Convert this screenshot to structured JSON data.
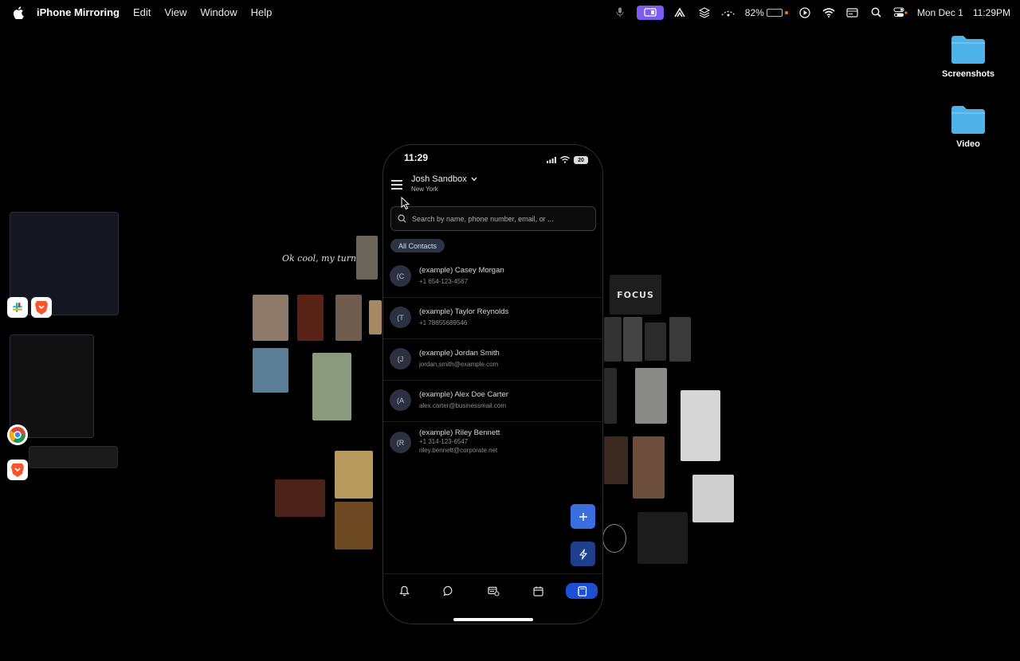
{
  "menubar": {
    "app_name": "iPhone Mirroring",
    "menus": [
      "Edit",
      "View",
      "Window",
      "Help"
    ],
    "battery_percent": "82%",
    "date": "Mon Dec 1",
    "time": "11:29PM",
    "icons": [
      "apple-icon",
      "microphone-icon",
      "screen-mirroring-icon",
      "cast-icon",
      "layers-icon",
      "battery-status-icon",
      "play-icon",
      "wifi-icon",
      "card-icon",
      "search-icon",
      "control-center-icon"
    ]
  },
  "desktop": {
    "folders": [
      {
        "label": "Screenshots"
      },
      {
        "label": "Video"
      }
    ],
    "background_text": "Ok cool, my turn",
    "background_poster_text": "FOCUS"
  },
  "phone": {
    "status_time": "11:29",
    "status_battery": "20",
    "account_name": "Josh Sandbox",
    "account_location": "New York",
    "search_placeholder": "Search by name, phone number, email, or ...",
    "filter_chip": "All Contacts",
    "contacts": [
      {
        "initial": "(C",
        "name": "(example) Casey Morgan",
        "line1": "+1 654-123-4567",
        "line2": ""
      },
      {
        "initial": "(T",
        "name": "(example) Taylor Reynolds",
        "line1": "+1 78655689546",
        "line2": ""
      },
      {
        "initial": "(J",
        "name": "(example) Jordan Smith",
        "line1": "jordan.smith@example.com",
        "line2": ""
      },
      {
        "initial": "(A",
        "name": "(example) Alex Doe Carter",
        "line1": "alex.carter@businessmail.com",
        "line2": ""
      },
      {
        "initial": "(R",
        "name": "(example) Riley Bennett",
        "line1": "+1 314-123-6547",
        "line2": "riley.bennett@corporate.net"
      }
    ],
    "tabs": [
      "bell-icon",
      "chat-icon",
      "inbox-icon",
      "calendar-icon",
      "contacts-icon"
    ],
    "active_tab": "contacts-icon"
  },
  "colors": {
    "accent": "#1c4fd1",
    "fab_add": "#3b6fe0",
    "fab_bolt": "#1f3f8c",
    "chip_bg": "#2b3347",
    "mirror_badge": "#7b5cf0",
    "battery_fill": "#f5c518",
    "battery_dot": "#f57c00",
    "folder": "#4fb3ea"
  }
}
